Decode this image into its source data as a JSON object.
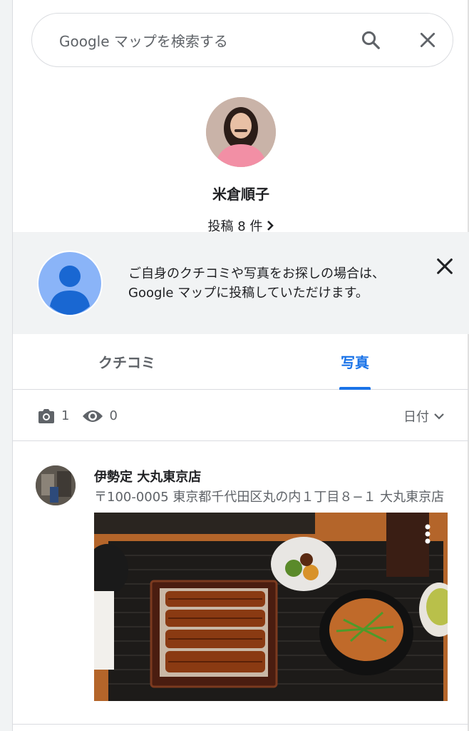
{
  "search": {
    "placeholder": "Google マップを検索する"
  },
  "profile": {
    "name": "米倉順子",
    "post_count": "投稿 8 件"
  },
  "banner": {
    "text": "ご自身のクチコミや写真をお探しの場合は、Google マップに投稿していただけます。"
  },
  "tabs": [
    {
      "label": "クチコミ",
      "active": false
    },
    {
      "label": "写真",
      "active": true
    }
  ],
  "stats": {
    "photos": "1",
    "views": "0",
    "sort_label": "日付"
  },
  "entry": {
    "name": "伊勢定 大丸東京店",
    "address": "〒100-0005 東京都千代田区丸の内１丁目８−１ 大丸東京店"
  },
  "colors": {
    "accent": "#1a73e8",
    "text_secondary": "#5f6368",
    "banner_bg": "#f1f3f4",
    "default_avatar": "#8ab4f8"
  }
}
